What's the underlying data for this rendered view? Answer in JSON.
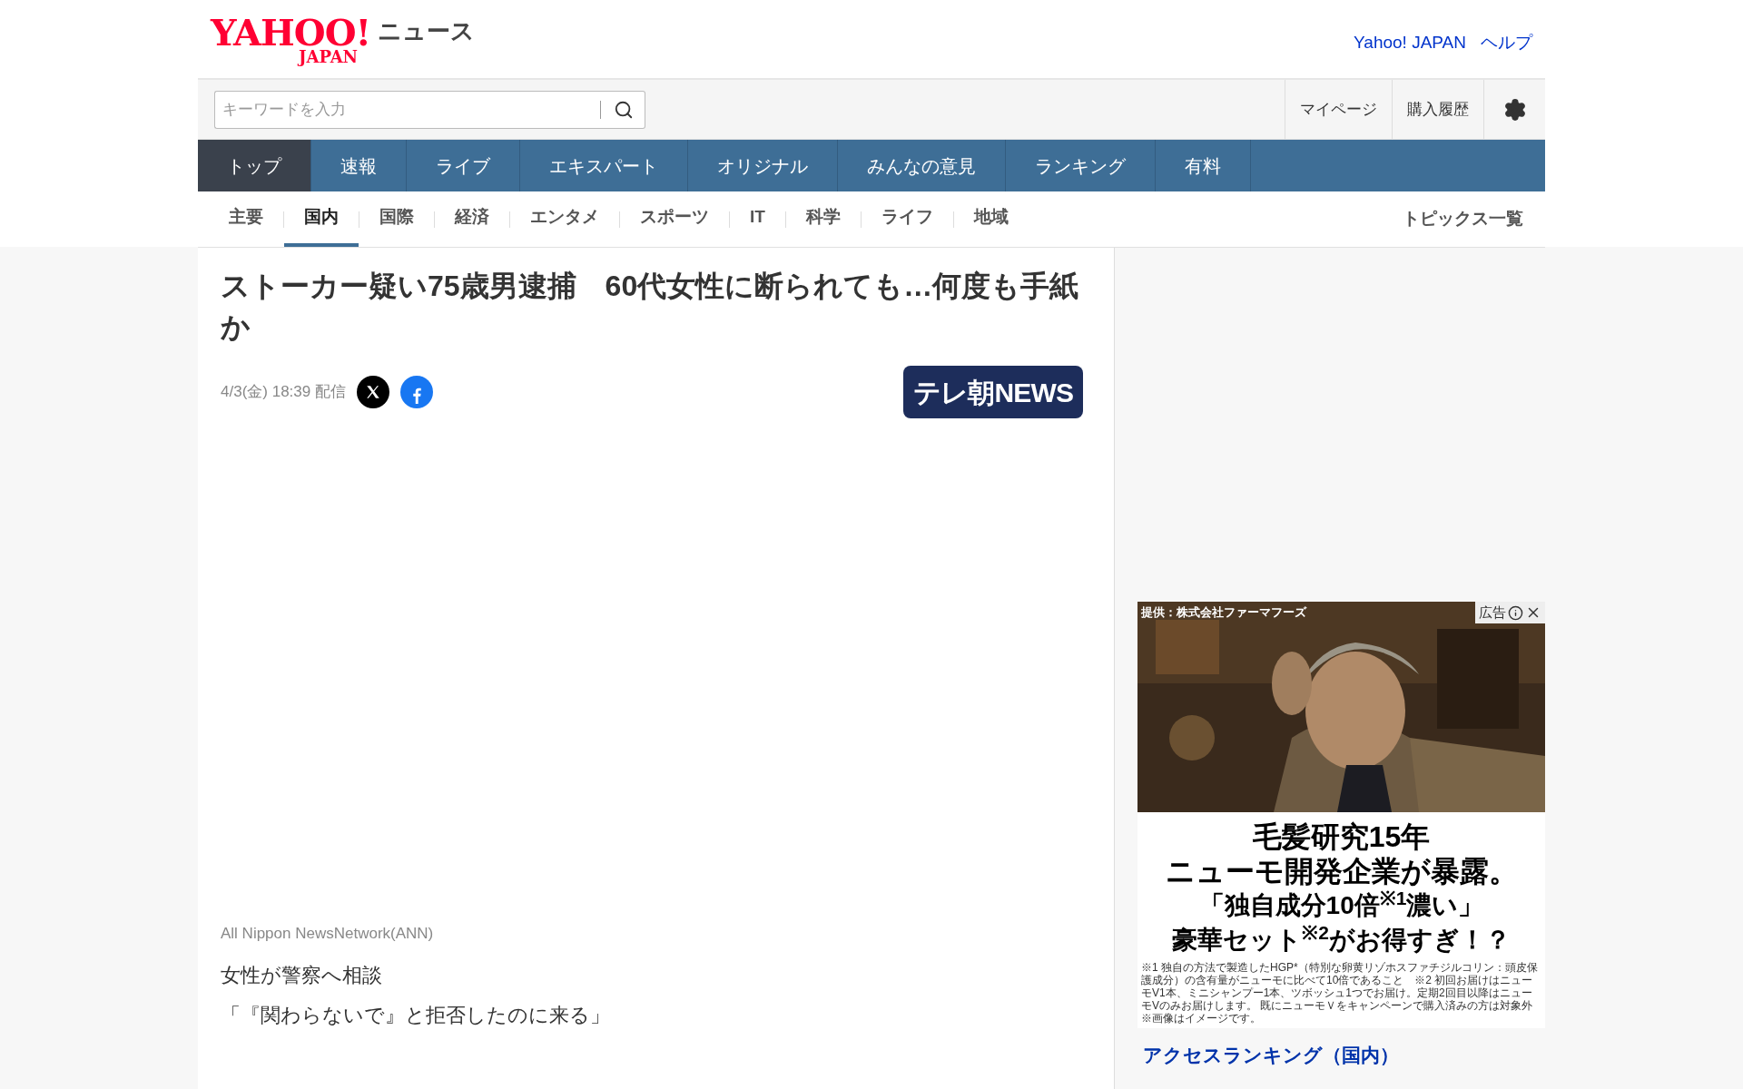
{
  "header": {
    "logo_main": "YAHOO!",
    "logo_sub": "JAPAN",
    "service": "ニュース",
    "links": [
      "Yahoo! JAPAN",
      "ヘルプ"
    ]
  },
  "search": {
    "placeholder": "キーワードを入力"
  },
  "user_links": [
    "マイページ",
    "購入履歴"
  ],
  "main_nav": [
    {
      "label": "トップ",
      "selected": true
    },
    {
      "label": "速報",
      "selected": false
    },
    {
      "label": "ライブ",
      "selected": false
    },
    {
      "label": "エキスパート",
      "selected": false
    },
    {
      "label": "オリジナル",
      "selected": false
    },
    {
      "label": "みんなの意見",
      "selected": false
    },
    {
      "label": "ランキング",
      "selected": false
    },
    {
      "label": "有料",
      "selected": false
    }
  ],
  "sub_nav": [
    {
      "label": "主要",
      "selected": false
    },
    {
      "label": "国内",
      "selected": true
    },
    {
      "label": "国際",
      "selected": false
    },
    {
      "label": "経済",
      "selected": false
    },
    {
      "label": "エンタメ",
      "selected": false
    },
    {
      "label": "スポーツ",
      "selected": false
    },
    {
      "label": "IT",
      "selected": false
    },
    {
      "label": "科学",
      "selected": false
    },
    {
      "label": "ライフ",
      "selected": false
    },
    {
      "label": "地域",
      "selected": false
    }
  ],
  "topics_link": "トピックス一覧",
  "article": {
    "title": "ストーカー疑い75歳男逮捕　60代女性に断られても…何度も手紙か",
    "date": "4/3(金) 18:39 配信",
    "source_logo": "テレ朝NEWS",
    "credit": "All Nippon NewsNetwork(ANN)",
    "body": [
      "女性が警察へ相談",
      "「『関わらないで』と拒否したのに来る」"
    ]
  },
  "ad": {
    "sponsor": "提供：株式会社ファーマフーズ",
    "label": "広告",
    "headline": [
      "毛髪研究15年",
      "ニューモ開発企業が暴露。",
      "「独自成分10倍$^{※1}$濃い」",
      "豪華セット$^{※2}$がお得すぎ！？"
    ],
    "footnote": "※1 独自の方法で製造したHGP*（特別な卵黄リゾホスファチジルコリン：頭皮保護成分）の含有量がニューモに比べて10倍であること　※2 初回お届けはニューモV1本、ミニシャンプー1本、ツボッシュ1つでお届け。定期2回目以降はニューモVのみお届けします。 既にニューモＶをキャンペーンで購入済みの方は対象外　※画像はイメージです。"
  },
  "ranking_title": "アクセスランキング（国内）"
}
